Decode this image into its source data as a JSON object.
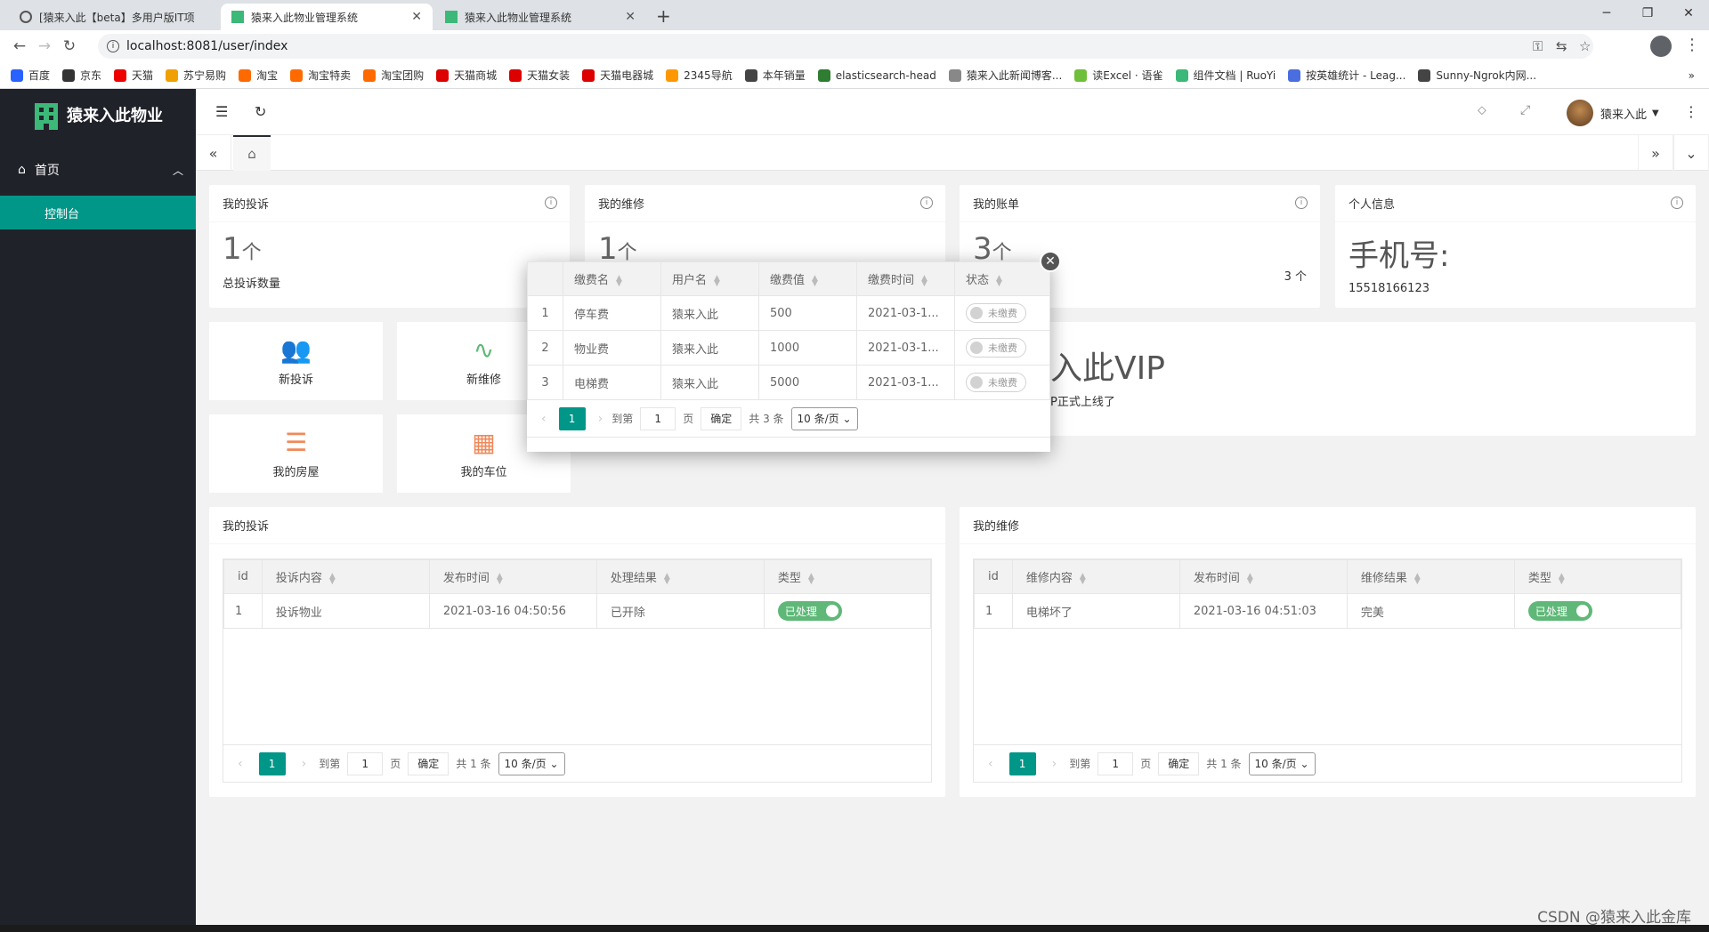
{
  "browser": {
    "tabs": [
      {
        "label": "[猿来入此【beta】多用户版IT项"
      },
      {
        "label": "猿来入此物业管理系统"
      },
      {
        "label": "猿来入此物业管理系统"
      }
    ],
    "url": "localhost:8081/user/index",
    "bookmarks": [
      "百度",
      "京东",
      "天猫",
      "苏宁易购",
      "淘宝",
      "淘宝特卖",
      "淘宝团购",
      "天猫商城",
      "天猫女装",
      "天猫电器城",
      "2345导航",
      "本年销量",
      "elasticsearch-head",
      "猿来入此新闻博客...",
      "读Excel · 语雀",
      "组件文档 | RuoYi",
      "按英雄统计 - Leag...",
      "Sunny-Ngrok内网..."
    ]
  },
  "app": {
    "logo": "猿来入此物业",
    "menu": {
      "group": "首页",
      "item": "控制台"
    },
    "user": "猿来入此"
  },
  "cards": {
    "complaint": {
      "title": "我的投诉",
      "num": "1",
      "unit": "个",
      "sub": "总投诉数量"
    },
    "repair": {
      "title": "我的维修",
      "num": "1",
      "unit": "个"
    },
    "bill": {
      "title": "我的账单",
      "num": "3",
      "unit": "个",
      "right": "3 个"
    },
    "personal": {
      "title": "个人信息",
      "phone_label": "手机号:",
      "phone": "15518166123"
    }
  },
  "shortcuts": [
    "新投诉",
    "新维修",
    "我的房屋",
    "我的车位"
  ],
  "vip": {
    "title": "入此VIP",
    "sub": "P正式上线了"
  },
  "complaints_table": {
    "title": "我的投诉",
    "headers": [
      "id",
      "投诉内容",
      "发布时间",
      "处理结果",
      "类型"
    ],
    "rows": [
      [
        "1",
        "投诉物业",
        "2021-03-16 04:50:56",
        "已开除",
        "已处理"
      ]
    ]
  },
  "repairs_table": {
    "title": "我的维修",
    "headers": [
      "id",
      "维修内容",
      "发布时间",
      "维修结果",
      "类型"
    ],
    "rows": [
      [
        "1",
        "电梯坏了",
        "2021-03-16 04:51:03",
        "完美",
        "已处理"
      ]
    ]
  },
  "pager": {
    "page": "1",
    "goto": "到第",
    "page_unit": "页",
    "confirm": "确定",
    "total": "共 1 条",
    "size": "10 条/页"
  },
  "modal": {
    "headers": [
      "缴费名",
      "用户名",
      "缴费值",
      "缴费时间",
      "状态"
    ],
    "rows": [
      [
        "1",
        "停车费",
        "猿来入此",
        "500",
        "2021-03-1...",
        "未缴费"
      ],
      [
        "2",
        "物业费",
        "猿来入此",
        "1000",
        "2021-03-1...",
        "未缴费"
      ],
      [
        "3",
        "电梯费",
        "猿来入此",
        "5000",
        "2021-03-1...",
        "未缴费"
      ]
    ],
    "pager": {
      "page": "1",
      "goto": "到第",
      "input": "1",
      "page_unit": "页",
      "confirm": "确定",
      "total": "共 3 条",
      "size": "10 条/页"
    }
  },
  "watermark": "CSDN @猿来入此金库"
}
